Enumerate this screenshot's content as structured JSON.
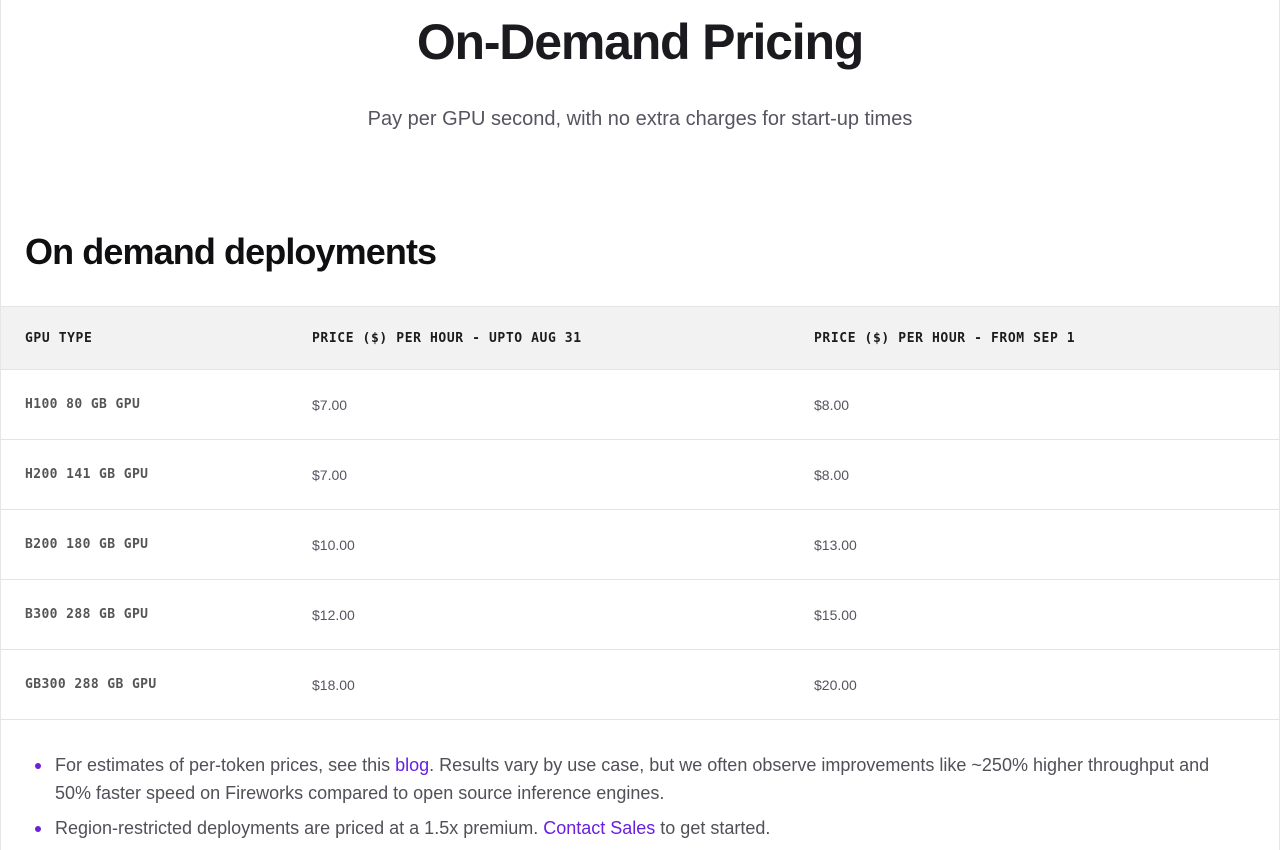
{
  "header": {
    "title": "On-Demand Pricing",
    "subtitle": "Pay per GPU second, with no extra charges for start-up times"
  },
  "section": {
    "heading": "On demand deployments"
  },
  "table": {
    "columns": [
      "GPU TYPE",
      "PRICE ($) PER HOUR - UPTO AUG 31",
      "PRICE ($) PER HOUR - FROM SEP 1"
    ],
    "rows": [
      [
        "H100 80 GB GPU",
        "$7.00",
        "$8.00"
      ],
      [
        "H200 141 GB GPU",
        "$7.00",
        "$8.00"
      ],
      [
        "B200 180 GB GPU",
        "$10.00",
        "$13.00"
      ],
      [
        "B300 288 GB GPU",
        "$12.00",
        "$15.00"
      ],
      [
        "GB300 288 GB GPU",
        "$18.00",
        "$20.00"
      ]
    ]
  },
  "notes": [
    {
      "before": "For estimates of per-token prices, see this ",
      "link": "blog",
      "after": ". Results vary by use case, but we often observe improvements like ~250% higher throughput and 50% faster speed on Fireworks compared to open source inference engines."
    },
    {
      "before": "Region-restricted deployments are priced at a 1.5x premium. ",
      "link": "Contact Sales",
      "after": " to get started."
    }
  ],
  "colors": {
    "accent": "#6720e0",
    "header_bg": "#f2f2f2",
    "divider": "#e4e4e7"
  }
}
